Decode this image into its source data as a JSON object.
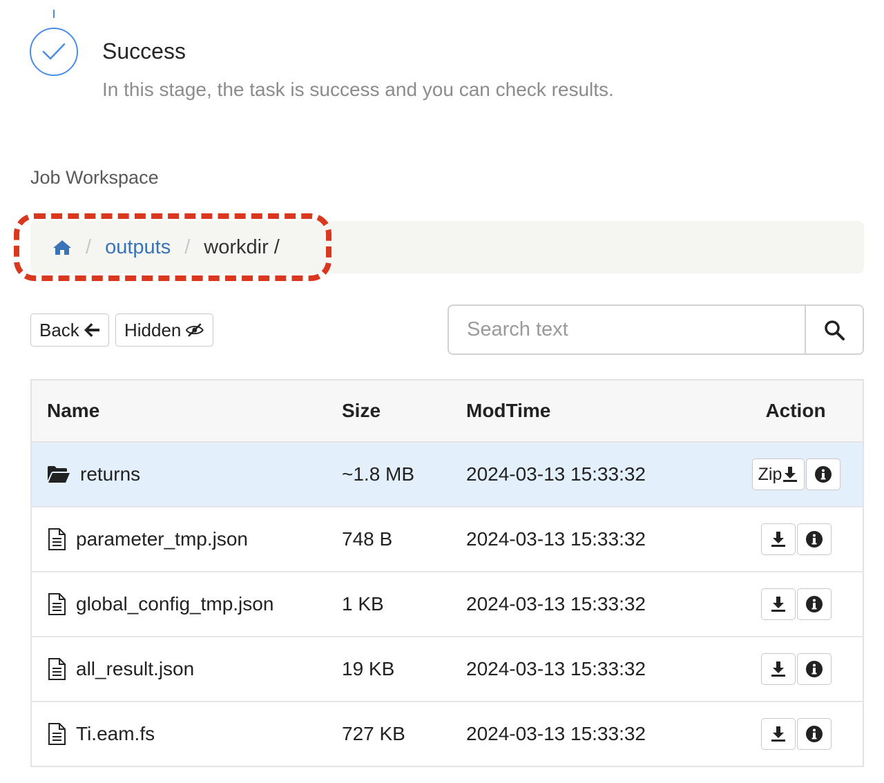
{
  "step": {
    "title": "Success",
    "description": "In this stage, the task is success and you can check results."
  },
  "workspace": {
    "label": "Job Workspace"
  },
  "breadcrumb": {
    "home_icon": "home-icon",
    "separator": "/",
    "items": [
      {
        "label": "outputs",
        "link": true
      },
      {
        "label": "workdir /",
        "link": false
      }
    ]
  },
  "toolbar": {
    "back_label": "Back",
    "hidden_label": "Hidden",
    "search_placeholder": "Search text",
    "search_value": ""
  },
  "table": {
    "columns": [
      "Name",
      "Size",
      "ModTime",
      "Action"
    ],
    "rows": [
      {
        "type": "folder",
        "name": "returns",
        "size": "~1.8 MB",
        "modtime": "2024-03-13 15:33:32",
        "action_label": "Zip",
        "active": true
      },
      {
        "type": "file",
        "name": "parameter_tmp.json",
        "size": "748 B",
        "modtime": "2024-03-13 15:33:32",
        "action_label": "",
        "active": false
      },
      {
        "type": "file",
        "name": "global_config_tmp.json",
        "size": "1 KB",
        "modtime": "2024-03-13 15:33:32",
        "action_label": "",
        "active": false
      },
      {
        "type": "file",
        "name": "all_result.json",
        "size": "19 KB",
        "modtime": "2024-03-13 15:33:32",
        "action_label": "",
        "active": false
      },
      {
        "type": "file",
        "name": "Ti.eam.fs",
        "size": "727 KB",
        "modtime": "2024-03-13 15:33:32",
        "action_label": "",
        "active": false
      }
    ]
  },
  "colors": {
    "accent": "#4a8de6",
    "link": "#3a73b8",
    "highlight": "#d9381e",
    "active_row": "#e3f0fb"
  }
}
